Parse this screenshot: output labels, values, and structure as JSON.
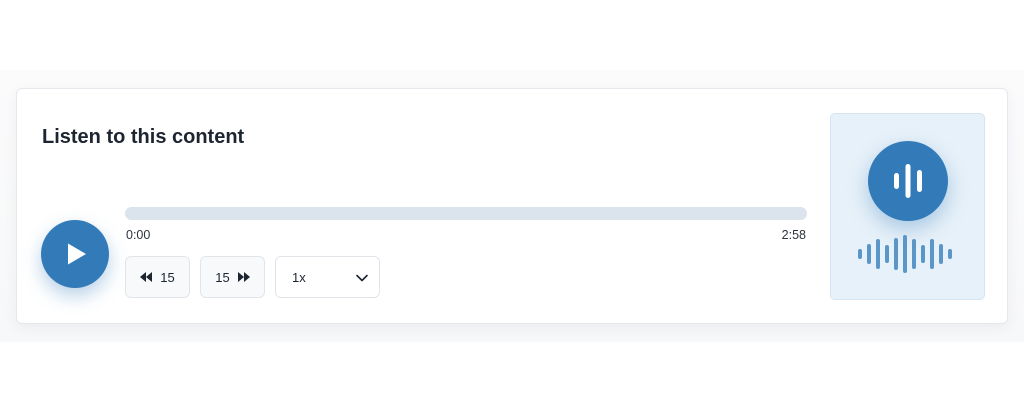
{
  "player": {
    "title": "Listen to this content",
    "play_icon": "play-icon",
    "progress": {
      "current_time": "0:00",
      "total_time": "2:58",
      "fraction": 0
    },
    "controls": {
      "rewind_seconds": "15",
      "rewind_icon": "rewind-icon",
      "forward_seconds": "15",
      "forward_icon": "fast-forward-icon",
      "speed_selected": "1x",
      "speed_icon": "chevron-down-icon"
    },
    "visual": {
      "circle_icon": "audio-bars-icon",
      "waveform_icon": "waveform-icon"
    }
  },
  "colors": {
    "accent": "#337ab9",
    "panel_bg": "#e7f1f9",
    "track": "#dbe3ed",
    "text": "#1d2531"
  }
}
